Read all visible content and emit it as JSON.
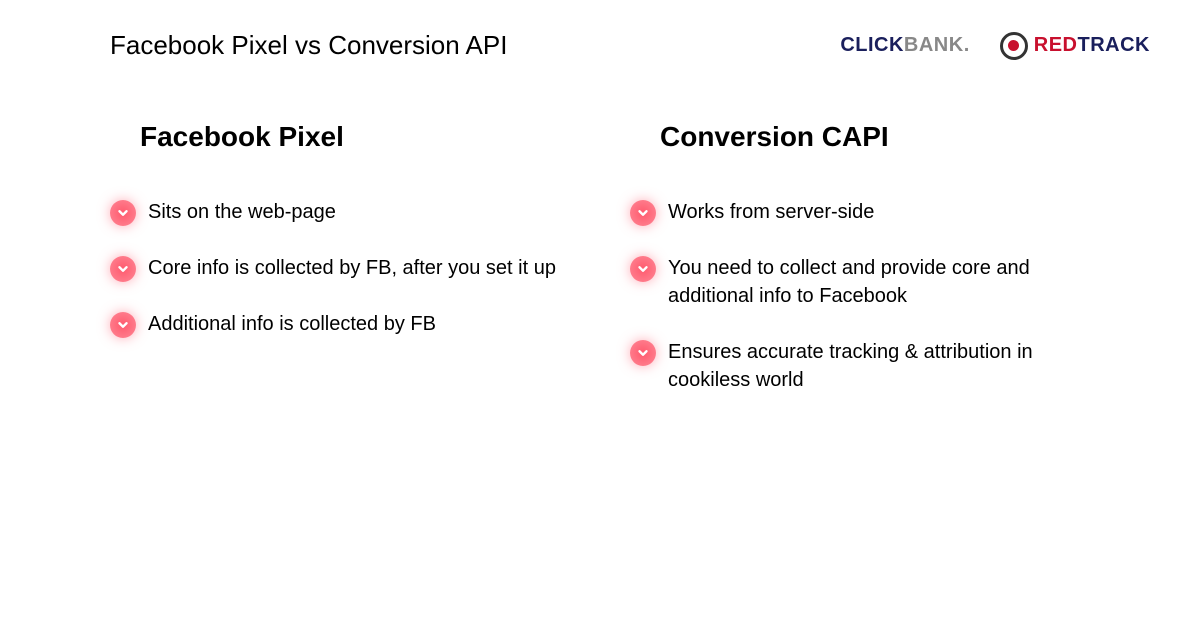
{
  "title": "Facebook Pixel vs Conversion API",
  "logos": {
    "clickbank": {
      "part1": "CLICK",
      "part2": "BANK."
    },
    "redtrack": {
      "part1": "RED",
      "part2": "TRACK"
    }
  },
  "columns": [
    {
      "heading": "Facebook Pixel",
      "items": [
        "Sits on the web-page",
        "Core info is collected by FB, after you set it up",
        "Additional info is collected by FB"
      ]
    },
    {
      "heading": "Conversion CAPI",
      "items": [
        "Works from server-side",
        "You need to collect and provide core and additional info to Facebook",
        "Ensures accurate tracking & attribution in cookiless world"
      ]
    }
  ]
}
